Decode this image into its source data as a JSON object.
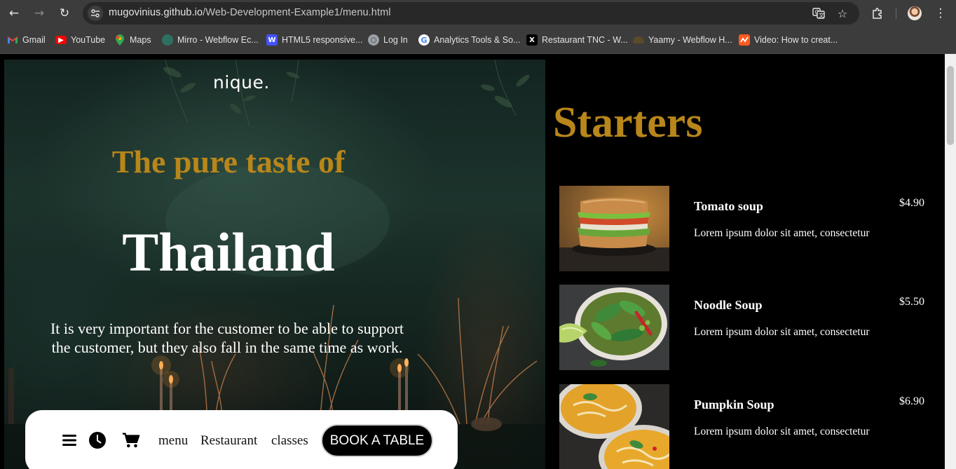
{
  "browser": {
    "url_host": "mugovinius.github.io",
    "url_path": "/Web-Development-Example1/menu.html",
    "bookmarks": [
      {
        "label": "Gmail",
        "icon": "gmail-icon",
        "color": "#ea4335"
      },
      {
        "label": "YouTube",
        "icon": "youtube-icon",
        "color": "#ff0000"
      },
      {
        "label": "Maps",
        "icon": "maps-icon",
        "color": "#34a853"
      },
      {
        "label": "Mirro - Webflow Ec...",
        "icon": "mirro-icon",
        "color": "#2f6f62"
      },
      {
        "label": "HTML5 responsive...",
        "icon": "webflow-w-icon",
        "color": "#4353ff"
      },
      {
        "label": "Log In",
        "icon": "globe-icon",
        "color": "#9aa0a6"
      },
      {
        "label": "Analytics Tools & So...",
        "icon": "google-icon",
        "color": "#4285f4"
      },
      {
        "label": "Restaurant TNC - W...",
        "icon": "x-icon",
        "color": "#000000"
      },
      {
        "label": "Yaamy - Webflow H...",
        "icon": "yaamy-icon",
        "color": "#c4a35a"
      },
      {
        "label": "Video: How to creat...",
        "icon": "video-icon",
        "color": "#ff5a1f"
      }
    ]
  },
  "hero": {
    "logo": "nique.",
    "subtitle": "The pure taste of",
    "title": "Thailand",
    "description": "It is very important for the customer to be able to support the customer, but they also fall in the same time as work."
  },
  "nav": {
    "links": [
      "menu",
      "Restaurant",
      "classes"
    ],
    "book_button": "BOOK A TABLE"
  },
  "menu": {
    "heading": "Starters",
    "items": [
      {
        "name": "Tomato soup",
        "price": "$4.90",
        "description": "Lorem ipsum dolor sit amet, consectetur"
      },
      {
        "name": "Noodle Soup",
        "price": "$5.50",
        "description": "Lorem ipsum dolor sit amet, consectetur"
      },
      {
        "name": "Pumpkin Soup",
        "price": "$6.90",
        "description": "Lorem ipsum dolor sit amet, consectetur"
      }
    ]
  },
  "colors": {
    "accent_gold": "#b8861a",
    "chrome_bg": "#3c3c3c",
    "omnibox_bg": "#282828"
  }
}
